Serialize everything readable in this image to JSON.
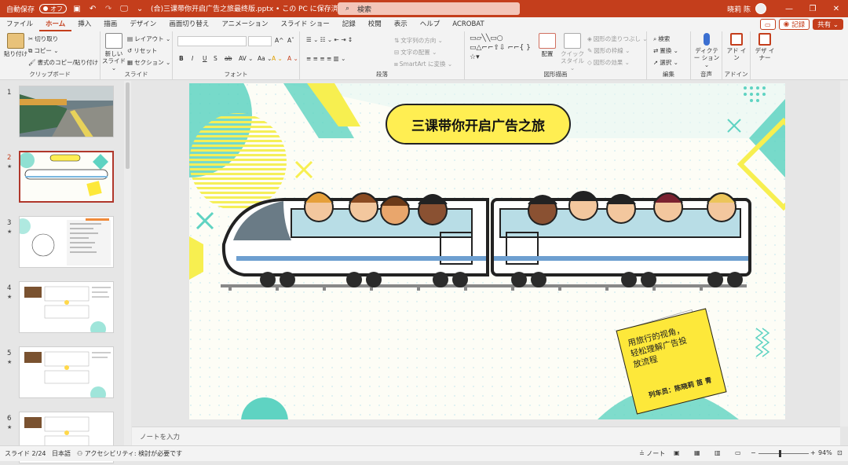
{
  "titlebar": {
    "autosave_label": "自動保存",
    "autosave_state": "オフ",
    "doc_title": "(合)三课带你开启广告之旅最终版.pptx • この PC に保存済み ⌄",
    "search_placeholder": "検索",
    "user_name": "晓莉 陈",
    "minimize": "—",
    "restore": "❐",
    "close": "✕"
  },
  "tabs": [
    "ファイル",
    "ホーム",
    "挿入",
    "描画",
    "デザイン",
    "画面切り替え",
    "アニメーション",
    "スライド ショー",
    "記録",
    "校閲",
    "表示",
    "ヘルプ",
    "ACROBAT"
  ],
  "active_tab": "ホーム",
  "tab_actions": {
    "comment_icon": "comment-icon",
    "record": "記録",
    "share": "共有 ⌄"
  },
  "ribbon": {
    "clipboard": {
      "paste": "貼り付け",
      "cut": "切り取り",
      "copy": "コピー ⌄",
      "format_painter": "書式のコピー/貼り付け",
      "label": "クリップボード"
    },
    "slides": {
      "new_slide": "新しい スライド ⌄",
      "layout": "レイアウト ⌄",
      "reset": "リセット",
      "section": "セクション ⌄",
      "label": "スライド"
    },
    "font": {
      "bold": "B",
      "italic": "I",
      "underline": "U",
      "shadow": "S",
      "strike": "ab",
      "spacing": "AV ⌄",
      "case": "Aa ⌄",
      "highlight": "A ⌄",
      "color": "A ⌄",
      "grow": "A^",
      "shrink": "Aˇ",
      "clear": "A",
      "label": "フォント"
    },
    "paragraph": {
      "text_direction": "文字列の方向 ⌄",
      "align_text": "文字の配置 ⌄",
      "smartart": "SmartArt に変換 ⌄",
      "label": "段落"
    },
    "drawing": {
      "arrange": "配置",
      "quick_styles": "クイック スタイル ⌄",
      "fill": "図形の塗りつぶし ⌄",
      "outline": "図形の枠線 ⌄",
      "effects": "図形の効果 ⌄",
      "label": "図形描画"
    },
    "editing": {
      "find": "検索",
      "replace": "置換 ⌄",
      "select": "選択 ⌄",
      "label": "編集"
    },
    "voice": {
      "dictate": "ディクテー ション ⌄",
      "label": "音声"
    },
    "addins": {
      "addins": "アド イン",
      "label": "アドイン"
    },
    "designer": {
      "designer": "デザ イナー"
    }
  },
  "thumbnails": [
    {
      "num": "1",
      "star": "",
      "selected": false
    },
    {
      "num": "2",
      "star": "★",
      "selected": true
    },
    {
      "num": "3",
      "star": "★",
      "selected": false
    },
    {
      "num": "4",
      "star": "★",
      "selected": false
    },
    {
      "num": "5",
      "star": "★",
      "selected": false
    },
    {
      "num": "6",
      "star": "★",
      "selected": false
    }
  ],
  "slide": {
    "title": "三课带你开启广告之旅",
    "note_text": "用旅行的视角，轻松理解广告投放流程",
    "note_byline": "列车员：陈晓莉 苗 青"
  },
  "notes_placeholder": "ノートを入力",
  "status": {
    "slide_counter": "スライド 2/24",
    "language": "日本語",
    "accessibility": "アクセシビリティ: 検討が必要です",
    "notes_btn": "ノート",
    "zoom": "94%"
  },
  "colors": {
    "brand": "#c43e1c",
    "teal": "#5fd3c2",
    "yellow": "#ffee52"
  }
}
